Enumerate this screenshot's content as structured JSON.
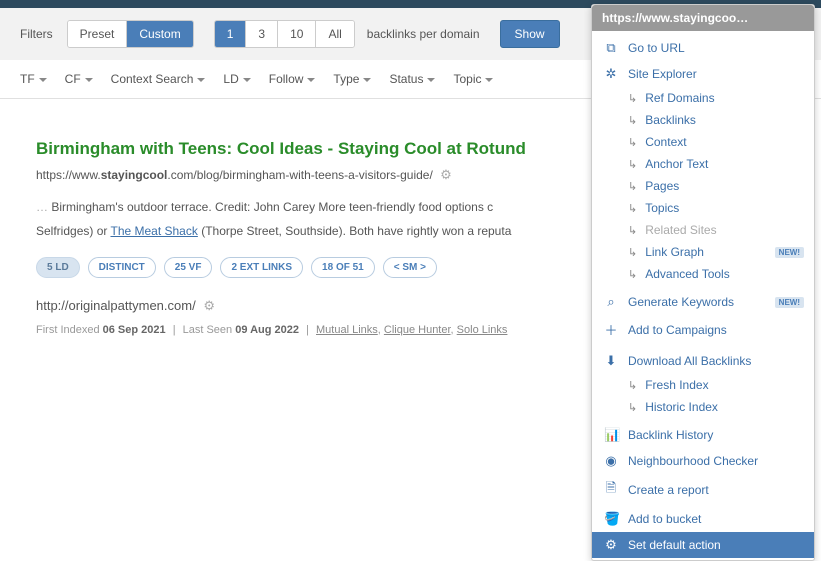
{
  "filters": {
    "label": "Filters",
    "preset": "Preset",
    "custom": "Custom",
    "pp1": "1",
    "pp3": "3",
    "pp10": "10",
    "ppAll": "All",
    "perDomain": "backlinks per domain",
    "show": "Show"
  },
  "dropdowns": {
    "tf": "TF",
    "cf": "CF",
    "context": "Context Search",
    "ld": "LD",
    "follow": "Follow",
    "type": "Type",
    "status": "Status",
    "topic": "Topic"
  },
  "result": {
    "title": "Birmingham with Teens: Cool Ideas - Staying Cool at Rotund",
    "urlPrefix": "https://www.",
    "urlBold": "stayingcool",
    "urlSuffix": ".com/blog/birmingham-with-teens-a-visitors-guide/",
    "ellipsis": "…",
    "snippet1": " Birmingham's outdoor terrace. Credit: John Carey More teen-friendly food options c",
    "snippet2a": "Selfridges) or ",
    "snippetLink": "The Meat Shack",
    "snippet2b": "  (Thorpe Street, Southside). Both have rightly won a reputa"
  },
  "pills": {
    "ld": "5 LD",
    "distinct": "DISTINCT",
    "vf": "25 VF",
    "ext": "2 EXT LINKS",
    "of": "18 OF 51",
    "sm": "< SM >"
  },
  "backlink": {
    "url": "http://originalpattymen.com/",
    "firstIndexedLabel": "First Indexed ",
    "firstIndexed": "06 Sep 2021",
    "lastSeenLabel": "Last Seen ",
    "lastSeen": "09 Aug 2022",
    "mutual": "Mutual Links",
    "clique": "Clique Hunter",
    "solo": "Solo Links"
  },
  "menu": {
    "header": "https://www.stayingcoo…",
    "goto": "Go to URL",
    "siteExplorer": "Site Explorer",
    "refDomains": "Ref Domains",
    "backlinks": "Backlinks",
    "context": "Context",
    "anchor": "Anchor Text",
    "pages": "Pages",
    "topics": "Topics",
    "related": "Related Sites",
    "linkGraph": "Link Graph",
    "advanced": "Advanced Tools",
    "genKeywords": "Generate Keywords",
    "addCampaigns": "Add to Campaigns",
    "downloadAll": "Download All Backlinks",
    "freshIndex": "Fresh Index",
    "historicIndex": "Historic Index",
    "backlinkHistory": "Backlink History",
    "neighbourhood": "Neighbourhood Checker",
    "createReport": "Create a report",
    "addBucket": "Add to bucket",
    "setDefault": "Set default action",
    "new": "NEW!"
  }
}
